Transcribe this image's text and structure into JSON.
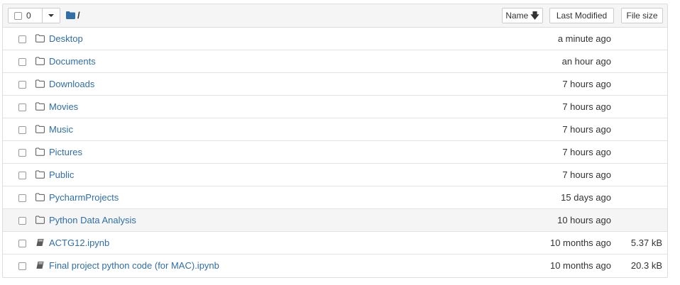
{
  "header": {
    "selected_count": "0",
    "breadcrumb_separator": "/",
    "sort_buttons": {
      "name": "Name",
      "last_modified": "Last Modified",
      "file_size": "File size"
    }
  },
  "colors": {
    "link": "#2f6ea7",
    "header_bg": "#f5f5f5",
    "border": "#dddddd"
  },
  "items": [
    {
      "type": "folder",
      "icon": "folder-outline-icon",
      "name": "Desktop",
      "modified": "a minute ago",
      "size": ""
    },
    {
      "type": "folder",
      "icon": "folder-outline-icon",
      "name": "Documents",
      "modified": "an hour ago",
      "size": ""
    },
    {
      "type": "folder",
      "icon": "folder-outline-icon",
      "name": "Downloads",
      "modified": "7 hours ago",
      "size": ""
    },
    {
      "type": "folder",
      "icon": "folder-outline-icon",
      "name": "Movies",
      "modified": "7 hours ago",
      "size": ""
    },
    {
      "type": "folder",
      "icon": "folder-outline-icon",
      "name": "Music",
      "modified": "7 hours ago",
      "size": ""
    },
    {
      "type": "folder",
      "icon": "folder-outline-icon",
      "name": "Pictures",
      "modified": "7 hours ago",
      "size": ""
    },
    {
      "type": "folder",
      "icon": "folder-outline-icon",
      "name": "Public",
      "modified": "7 hours ago",
      "size": ""
    },
    {
      "type": "folder",
      "icon": "folder-outline-icon",
      "name": "PycharmProjects",
      "modified": "15 days ago",
      "size": ""
    },
    {
      "type": "folder",
      "icon": "folder-outline-icon",
      "name": "Python Data Analysis",
      "modified": "10 hours ago",
      "size": "",
      "hover": true
    },
    {
      "type": "notebook",
      "icon": "notebook-icon",
      "name": "ACTG12.ipynb",
      "modified": "10 months ago",
      "size": "5.37 kB"
    },
    {
      "type": "notebook",
      "icon": "notebook-icon",
      "name": "Final project python code (for MAC).ipynb",
      "modified": "10 months ago",
      "size": "20.3 kB"
    }
  ]
}
